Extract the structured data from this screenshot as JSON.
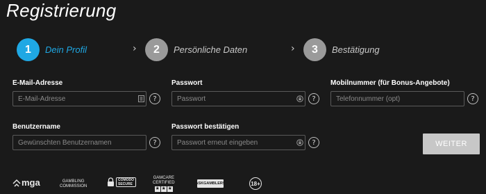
{
  "page": {
    "title": "Registrierung"
  },
  "stepper": {
    "steps": [
      {
        "number": "1",
        "label": "Dein Profil",
        "active": true
      },
      {
        "number": "2",
        "label": "Persönliche Daten",
        "active": false
      },
      {
        "number": "3",
        "label": "Bestätigung",
        "active": false
      }
    ]
  },
  "form": {
    "email": {
      "label": "E-Mail-Adresse",
      "placeholder": "E-Mail-Adresse",
      "value": ""
    },
    "password": {
      "label": "Passwort",
      "placeholder": "Passwort",
      "value": ""
    },
    "mobile": {
      "label": "Mobilnummer (für Bonus-Angebote)",
      "placeholder": "Telefonnummer (opt)",
      "value": ""
    },
    "username": {
      "label": "Benutzername",
      "placeholder": "Gewünschten Benutzernamen",
      "value": ""
    },
    "password_confirm": {
      "label": "Passwort bestätigen",
      "placeholder": "Passwort erneut eingeben",
      "value": ""
    },
    "help_glyph": "?",
    "submit_label": "WEITER"
  },
  "footer": {
    "logos": {
      "mga": "mga",
      "gambling_commission_line1": "GAMBLING",
      "gambling_commission_line2": "COMMISSION",
      "comodo_line1": "COMODO",
      "comodo_line2": "SECURE",
      "gamcare_line1": "GAMCARE",
      "gamcare_line2": "CERTIFIED",
      "askgamblers": "ASKGAMBLERS",
      "age": "18+"
    }
  },
  "colors": {
    "background": "#1a1a1a",
    "accent": "#1fa8e4",
    "inactive_step": "#9a9a9a",
    "button": "#c7c7c7"
  }
}
